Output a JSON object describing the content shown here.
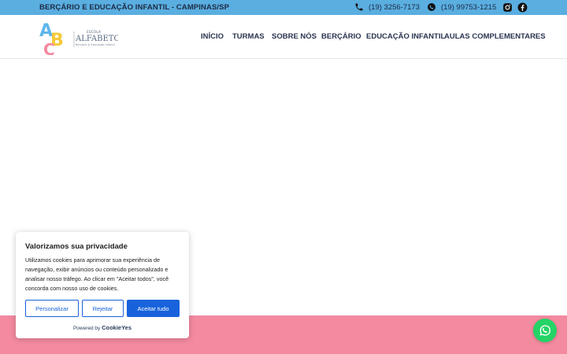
{
  "topbar": {
    "tagline": "BERÇÁRIO E EDUCAÇÃO INFANTIL - CAMPINAS/SP",
    "phone": {
      "icon": "phone-icon",
      "number": "(19) 3256-7173"
    },
    "whatsapp": {
      "icon": "whatsapp-icon",
      "number": "(19) 99753-1215"
    },
    "social": [
      "instagram-icon",
      "facebook-icon"
    ]
  },
  "logo": {
    "letters": [
      "A",
      "B",
      "C"
    ],
    "line1": "ESCOLA",
    "line2": "ALFABETO",
    "line3": "Berçário & Educação Infantil"
  },
  "nav": {
    "items": [
      "INÍCIO",
      "TURMAS",
      "SOBRE NÓS",
      "BERÇÁRIO",
      "EDUCAÇÃO INFANTIL",
      "AULAS COMPLEMENTARES"
    ]
  },
  "cookie": {
    "title": "Valorizamos sua privacidade",
    "body": "Utilizamos cookies para aprimorar sua experiência de navegação, exibir anúncios ou conteúdo personalizado e analisar nosso tráfego. Ao clicar em \"Aceitar todos\", você concorda com nosso uso de cookies.",
    "buttons": {
      "customize": "Personalizar",
      "reject": "Rejeitar",
      "accept": "Aceitar tudo"
    },
    "powered_by": "Powered by",
    "brand": "CookieYes"
  },
  "colors": {
    "topbar": "#5aaee0",
    "pink_band": "#f38aa0",
    "cookie_accent": "#1863dc",
    "whatsapp": "#25d366"
  }
}
